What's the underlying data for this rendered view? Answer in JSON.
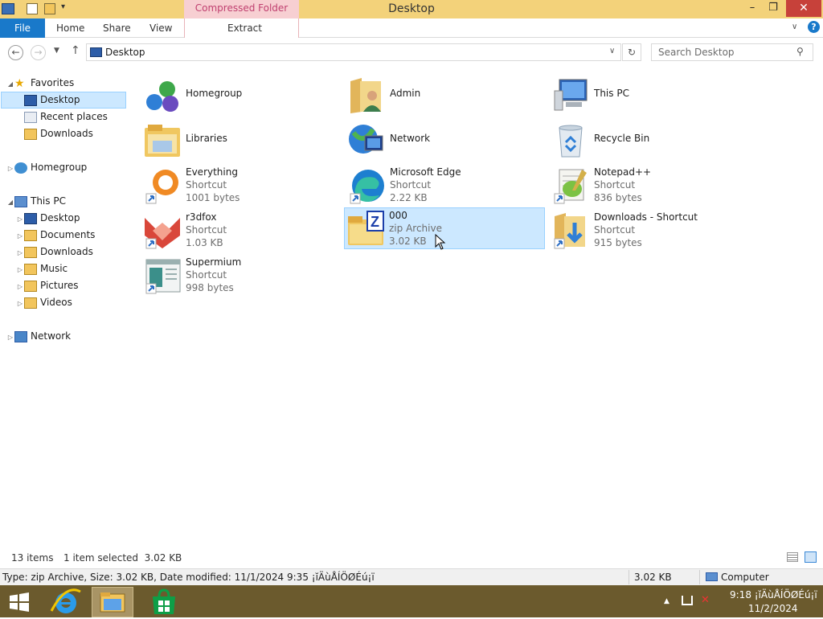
{
  "window": {
    "title": "Desktop",
    "context_tab": "Compressed Folder Tools"
  },
  "ribbon": {
    "tabs": [
      "File",
      "Home",
      "Share",
      "View"
    ],
    "extract_label": "Extract"
  },
  "address": {
    "path": "Desktop",
    "search_placeholder": "Search Desktop"
  },
  "nav": {
    "favorites": {
      "label": "Favorites",
      "items": [
        "Desktop",
        "Recent places",
        "Downloads"
      ]
    },
    "homegroup": "Homegroup",
    "this_pc": {
      "label": "This PC",
      "items": [
        "Desktop",
        "Documents",
        "Downloads",
        "Music",
        "Pictures",
        "Videos"
      ]
    },
    "network": "Network"
  },
  "items": [
    {
      "name": "Homegroup",
      "type": "",
      "size": "",
      "icon": "homegroup-icon"
    },
    {
      "name": "Admin",
      "type": "",
      "size": "",
      "icon": "user-folder-icon"
    },
    {
      "name": "This PC",
      "type": "",
      "size": "",
      "icon": "this-pc-icon"
    },
    {
      "name": "Libraries",
      "type": "",
      "size": "",
      "icon": "libraries-icon"
    },
    {
      "name": "Network",
      "type": "",
      "size": "",
      "icon": "network-icon"
    },
    {
      "name": "Recycle Bin",
      "type": "",
      "size": "",
      "icon": "recycle-bin-icon"
    },
    {
      "name": "Everything",
      "type": "Shortcut",
      "size": "1001 bytes",
      "icon": "everything-icon"
    },
    {
      "name": "Microsoft Edge",
      "type": "Shortcut",
      "size": "2.22 KB",
      "icon": "edge-icon"
    },
    {
      "name": "Notepad++",
      "type": "Shortcut",
      "size": "836 bytes",
      "icon": "notepadpp-icon"
    },
    {
      "name": "r3dfox",
      "type": "Shortcut",
      "size": "1.03 KB",
      "icon": "r3dfox-icon"
    },
    {
      "name": "000",
      "type": "zip Archive",
      "size": "3.02 KB",
      "icon": "zip-folder-icon"
    },
    {
      "name": "Downloads - Shortcut",
      "type": "Shortcut",
      "size": "915 bytes",
      "icon": "downloads-folder-icon"
    },
    {
      "name": "Supermium",
      "type": "Shortcut",
      "size": "998 bytes",
      "icon": "supermium-icon"
    }
  ],
  "status": {
    "count": "13 items",
    "selection": "1 item selected  3.02 KB"
  },
  "details": {
    "text": "Type: zip Archive, Size: 3.02 KB, Date modified: 11/1/2024 9:35 ¡ĭÄùÅÍÖØÉú¡ï",
    "size": "3.02 KB",
    "location": "Computer"
  },
  "taskbar": {
    "time": "9:18 ¡ĭÄùÅÍÖØÉú¡ï",
    "date": "11/2/2024"
  },
  "colors": {
    "titlebar": "#f3d27a",
    "file_tab": "#1979ca",
    "selection": "#cce8ff",
    "close": "#c7413a",
    "taskbar": "#6b5a2d"
  }
}
